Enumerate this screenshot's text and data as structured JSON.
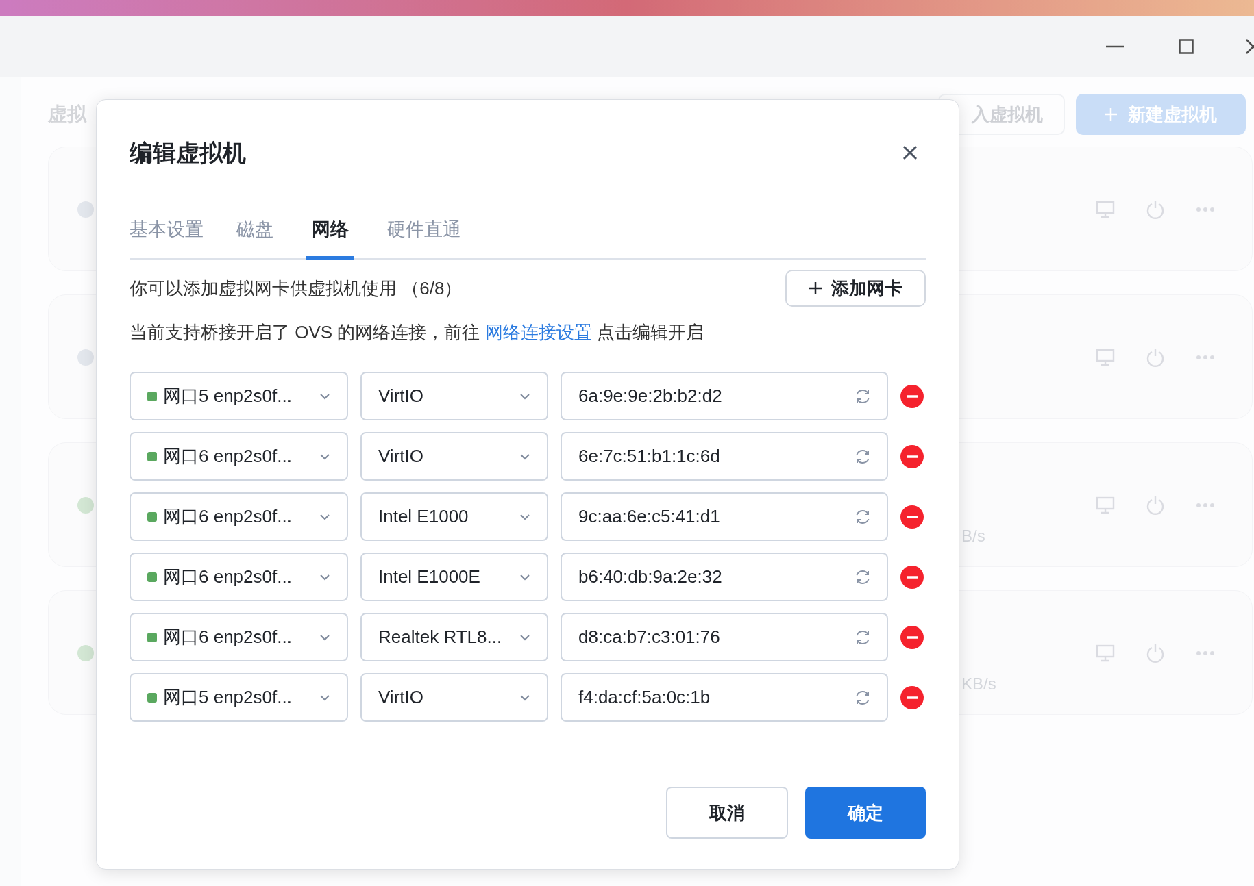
{
  "background": {
    "page_title": "虚拟",
    "buttons": [
      {
        "label": "入虚拟机",
        "kind": "outline"
      },
      {
        "label": "新建虚拟机",
        "kind": "primary"
      }
    ],
    "vm_cards": [
      {
        "color": "#dde1e9"
      },
      {
        "color": "#dde1e9"
      },
      {
        "color": "#c8e2ca",
        "speed": "B/s"
      },
      {
        "color": "#c8e2ca",
        "speed": "KB/s"
      }
    ]
  },
  "dialog": {
    "title": "编辑虚拟机",
    "tabs": [
      {
        "label": "基本设置",
        "selected": false
      },
      {
        "label": "磁盘",
        "selected": false
      },
      {
        "label": "网络",
        "selected": true
      },
      {
        "label": "硬件直通",
        "selected": false
      }
    ],
    "info": "你可以添加虚拟网卡供虚拟机使用 （6/8）",
    "add_button": "添加网卡",
    "notice": {
      "before": "当前支持桥接开启了 OVS 的网络连接，前往",
      "link": "网络连接设置",
      "after": "点击编辑开启"
    },
    "nics": [
      {
        "port": "网口5 enp2s0f...",
        "color": "#5aa85f",
        "model": "VirtIO",
        "mac": "6a:9e:9e:2b:b2:d2"
      },
      {
        "port": "网口6 enp2s0f...",
        "color": "#5aa85f",
        "model": "VirtIO",
        "mac": "6e:7c:51:b1:1c:6d"
      },
      {
        "port": "网口6 enp2s0f...",
        "color": "#5aa85f",
        "model": "Intel E1000",
        "mac": "9c:aa:6e:c5:41:d1"
      },
      {
        "port": "网口6 enp2s0f...",
        "color": "#5aa85f",
        "model": "Intel E1000E",
        "mac": "b6:40:db:9a:2e:32"
      },
      {
        "port": "网口6 enp2s0f...",
        "color": "#5aa85f",
        "model": "Realtek RTL8...",
        "mac": "d8:ca:b7:c3:01:76"
      },
      {
        "port": "网口5 enp2s0f...",
        "color": "#5aa85f",
        "model": "VirtIO",
        "mac": "f4:da:cf:5a:0c:1b"
      }
    ],
    "buttons": [
      {
        "label": "取消",
        "kind": "secondary"
      },
      {
        "label": "确定",
        "kind": "primary"
      }
    ]
  }
}
